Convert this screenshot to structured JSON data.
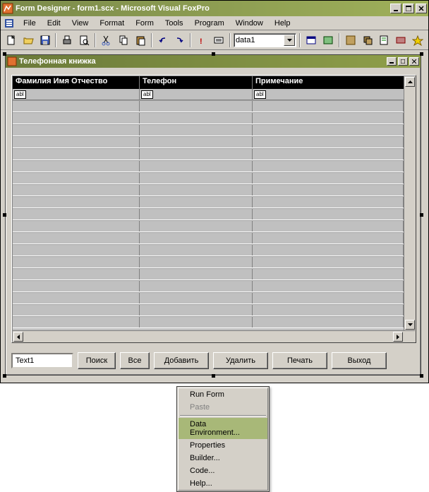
{
  "app": {
    "title": "Form Designer - form1.scx - Microsoft Visual FoxPro"
  },
  "menu": {
    "items": [
      "File",
      "Edit",
      "View",
      "Format",
      "Form",
      "Tools",
      "Program",
      "Window",
      "Help"
    ]
  },
  "toolbar": {
    "combo_value": "data1"
  },
  "inner_form": {
    "title": "Телефонная книжка"
  },
  "grid": {
    "columns": [
      "Фамилия Имя Отчество",
      "Телефон",
      "Примечание"
    ],
    "field_placeholder": "abl"
  },
  "controls": {
    "text_value": "Text1",
    "buttons": {
      "search": "Поиск",
      "all": "Все",
      "add": "Добавить",
      "delete": "Удалить",
      "print": "Печать",
      "exit": "Выход"
    }
  },
  "context_menu": {
    "run_form": "Run Form",
    "paste": "Paste",
    "data_environment": "Data Environment...",
    "properties": "Properties",
    "builder": "Builder...",
    "code": "Code...",
    "help": "Help..."
  }
}
